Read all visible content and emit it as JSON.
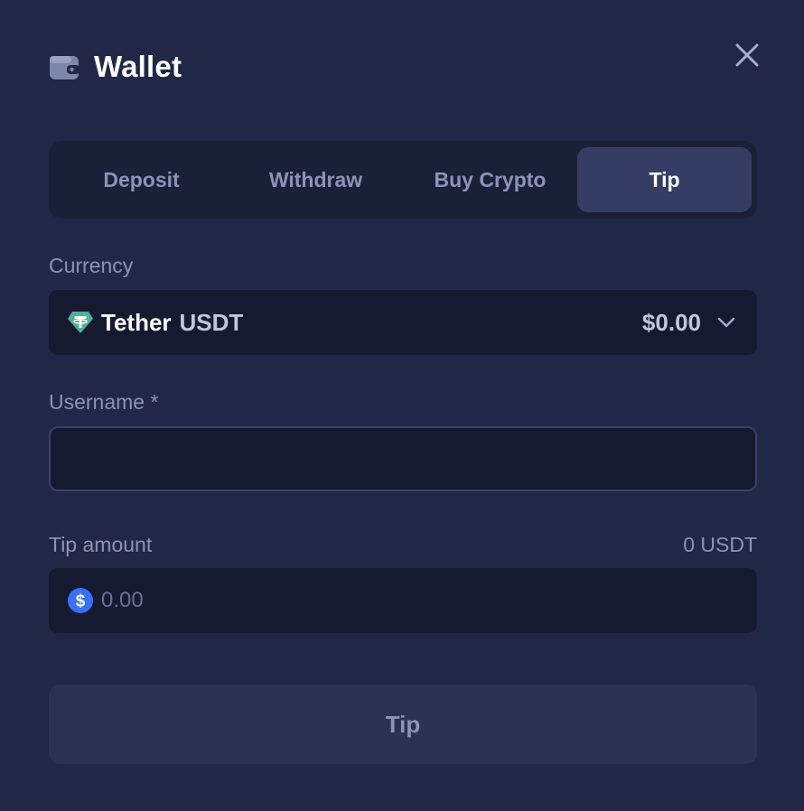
{
  "header": {
    "title": "Wallet",
    "icon": "wallet-icon",
    "close_icon": "close-icon"
  },
  "tabs": [
    {
      "label": "Deposit",
      "active": false
    },
    {
      "label": "Withdraw",
      "active": false
    },
    {
      "label": "Buy Crypto",
      "active": false
    },
    {
      "label": "Tip",
      "active": true
    }
  ],
  "currency": {
    "label": "Currency",
    "name": "Tether",
    "code": "USDT",
    "balance": "$0.00",
    "icon": "tether-icon",
    "dropdown_icon": "chevron-down-icon"
  },
  "username": {
    "label": "Username *",
    "value": "",
    "placeholder": ""
  },
  "tip_amount": {
    "label": "Tip amount",
    "unit_balance": "0 USDT",
    "value": "",
    "placeholder": "0.00",
    "icon": "dollar-coin-icon"
  },
  "submit": {
    "label": "Tip"
  },
  "colors": {
    "background": "#212746",
    "tab_bar": "#1b2039",
    "active_tab": "#363d64",
    "field": "#151a31",
    "muted_text": "#8d93b5",
    "tether_green": "#50af95",
    "dollar_blue": "#3a6ff7"
  }
}
